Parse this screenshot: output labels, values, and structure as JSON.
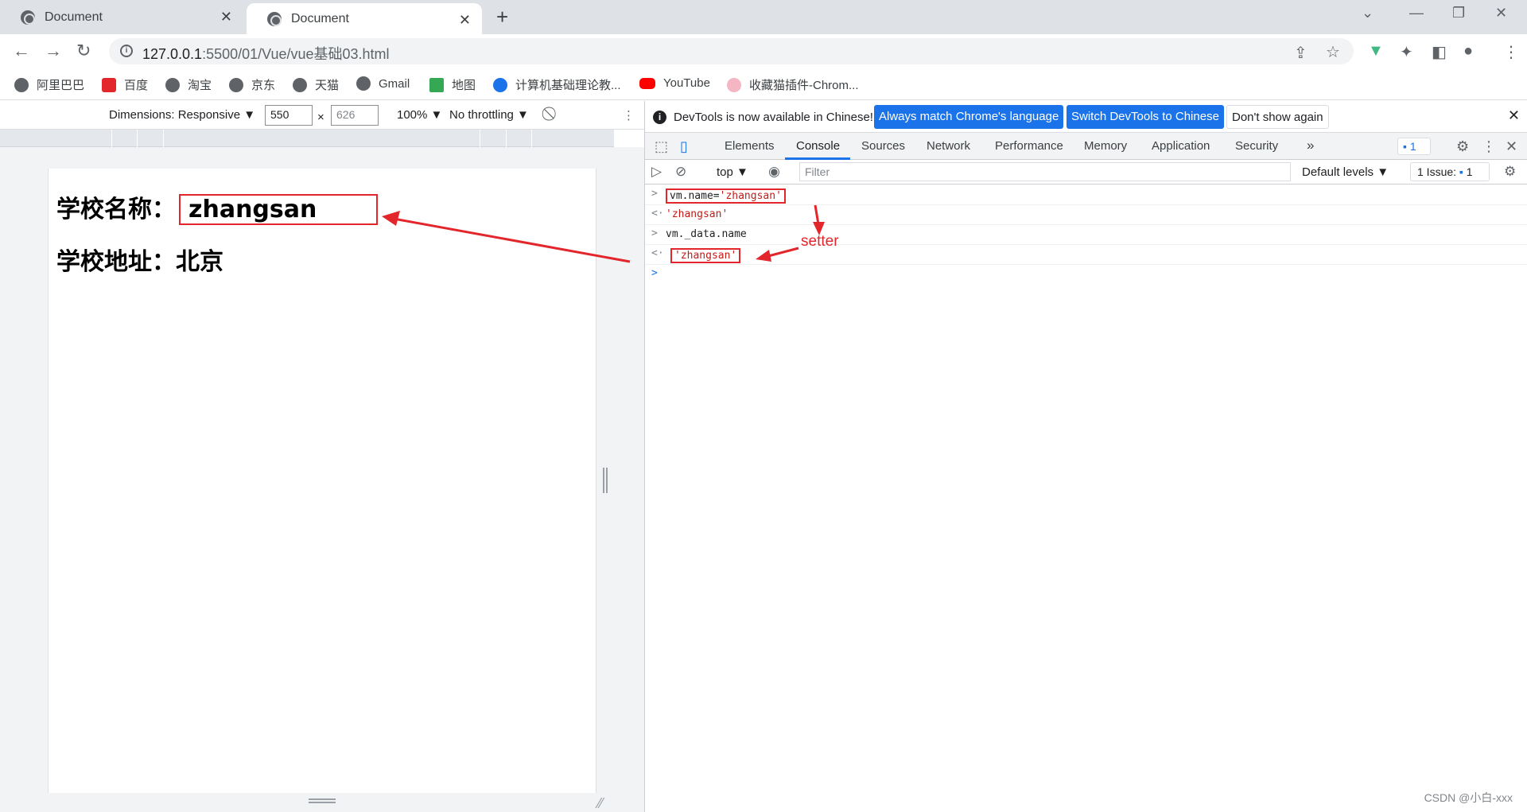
{
  "browser": {
    "tabs": [
      {
        "title": "Document",
        "active": false
      },
      {
        "title": "Document",
        "active": true
      }
    ],
    "url_host": "127.0.0.1",
    "url_path": ":5500/01/Vue/vue基础03.html"
  },
  "bookmarks": [
    {
      "label": "阿里巴巴",
      "icon": "globe-icon"
    },
    {
      "label": "百度",
      "icon": "baidu-icon"
    },
    {
      "label": "淘宝",
      "icon": "globe-icon"
    },
    {
      "label": "京东",
      "icon": "globe-icon"
    },
    {
      "label": "天猫",
      "icon": "globe-icon"
    },
    {
      "label": "Gmail",
      "icon": "globe-icon"
    },
    {
      "label": "地图",
      "icon": "maps-icon"
    },
    {
      "label": "计算机基础理论教...",
      "icon": "site-icon"
    },
    {
      "label": "YouTube",
      "icon": "youtube-icon"
    },
    {
      "label": "收藏猫插件-Chrom...",
      "icon": "cat-icon"
    }
  ],
  "device_toolbar": {
    "dimensions_label": "Dimensions: Responsive ▼",
    "width": "550",
    "times": "×",
    "height": "626",
    "zoom": "100% ▼",
    "throttling": "No throttling ▼"
  },
  "page": {
    "name_label": "学校名称：",
    "name_value": "zhangsan",
    "address_label": "学校地址：",
    "address_value": "北京"
  },
  "devtools": {
    "info_text": "DevTools is now available in Chinese!",
    "btn_match": "Always match Chrome's language",
    "btn_switch": "Switch DevTools to Chinese",
    "btn_dont_show": "Don't show again",
    "tabs": [
      "Elements",
      "Console",
      "Sources",
      "Network",
      "Performance",
      "Memory",
      "Application",
      "Security"
    ],
    "more_tabs": "»",
    "issues_badge": "1",
    "context": "top ▼",
    "filter_placeholder": "Filter",
    "levels": "Default levels ▼",
    "issue_count": "1 Issue:",
    "issue_num": "1"
  },
  "console": {
    "lines": [
      {
        "marker": ">",
        "code_prefix": "vm.name=",
        "code_string": "'zhangsan'"
      },
      {
        "marker": "<·",
        "code_string": "'zhangsan'"
      },
      {
        "marker": ">",
        "code_prefix": "vm._data.name"
      },
      {
        "marker": "<·",
        "code_string": "'zhangsan'"
      },
      {
        "marker": ">"
      }
    ]
  },
  "annotations": {
    "setter_label": "setter",
    "accent_color": "#e3262c"
  },
  "watermark": "CSDN @小白-xxx"
}
